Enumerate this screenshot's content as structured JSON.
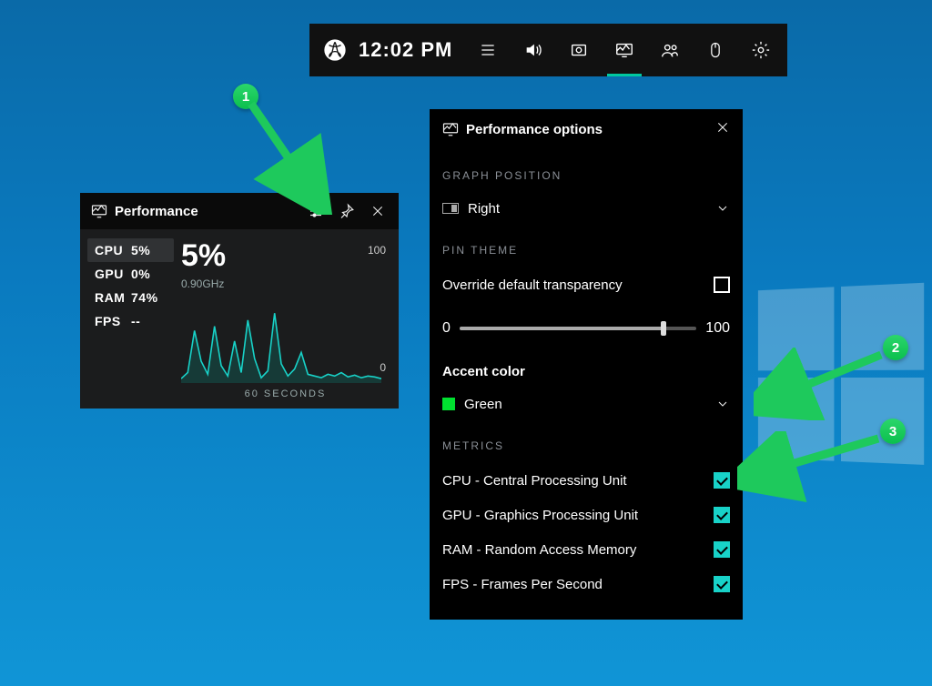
{
  "gamebar": {
    "time": "12:02 PM"
  },
  "perf_widget": {
    "title": "Performance",
    "metrics": [
      {
        "label": "CPU",
        "value": "5%",
        "selected": true
      },
      {
        "label": "GPU",
        "value": "0%",
        "selected": false
      },
      {
        "label": "RAM",
        "value": "74%",
        "selected": false
      },
      {
        "label": "FPS",
        "value": "--",
        "selected": false
      }
    ],
    "big_value": "5%",
    "sub_value": "0.90GHz",
    "y_max": "100",
    "y_min": "0",
    "x_label": "60 SECONDS"
  },
  "options": {
    "title": "Performance options",
    "graph_position": {
      "header": "GRAPH POSITION",
      "value": "Right"
    },
    "pin_theme": {
      "header": "PIN THEME",
      "override_label": "Override default transparency",
      "override_checked": false,
      "slider_min": "0",
      "slider_max": "100",
      "slider_value": 86
    },
    "accent": {
      "header": "Accent color",
      "value": "Green",
      "swatch": "#00e030"
    },
    "metrics": {
      "header": "METRICS",
      "items": [
        {
          "label": "CPU - Central Processing Unit",
          "checked": true
        },
        {
          "label": "GPU - Graphics Processing Unit",
          "checked": true
        },
        {
          "label": "RAM - Random Access Memory",
          "checked": true
        },
        {
          "label": "FPS - Frames Per Second",
          "checked": true
        }
      ]
    }
  },
  "annotations": {
    "1": "1",
    "2": "2",
    "3": "3"
  },
  "chart_data": {
    "type": "line",
    "title": "CPU usage",
    "xlabel": "60 SECONDS",
    "ylabel": "%",
    "ylim": [
      0,
      100
    ],
    "x": [
      0,
      2,
      4,
      6,
      8,
      10,
      12,
      14,
      16,
      18,
      20,
      22,
      24,
      26,
      28,
      30,
      32,
      34,
      36,
      38,
      40,
      42,
      44,
      46,
      48,
      50,
      52,
      54,
      56,
      58,
      60
    ],
    "series": [
      {
        "name": "CPU",
        "values": [
          5,
          12,
          60,
          25,
          10,
          65,
          20,
          8,
          48,
          12,
          72,
          28,
          6,
          14,
          80,
          22,
          8,
          16,
          35,
          10,
          8,
          6,
          10,
          8,
          12,
          7,
          9,
          6,
          8,
          7,
          5
        ]
      }
    ]
  }
}
